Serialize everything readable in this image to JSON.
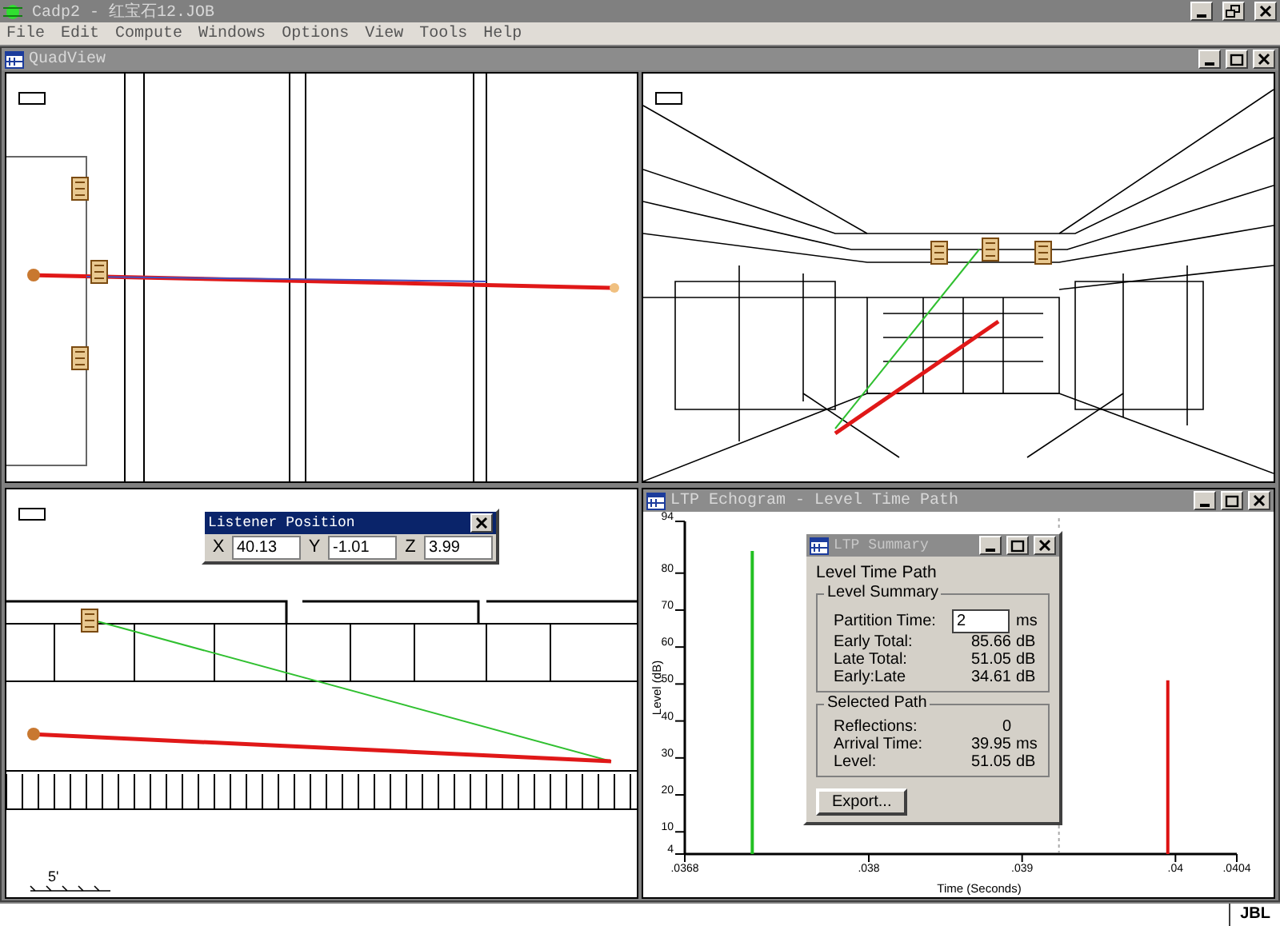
{
  "window": {
    "title": "Cadp2 - 红宝石12.JOB"
  },
  "menu": [
    "File",
    "Edit",
    "Compute",
    "Windows",
    "Options",
    "View",
    "Tools",
    "Help"
  ],
  "quadview": {
    "title": "QuadView"
  },
  "elevation_view": {
    "scale_label": "5'"
  },
  "listener_position": {
    "title": "Listener Position",
    "fields": [
      {
        "label": "X",
        "value": "40.13"
      },
      {
        "label": "Y",
        "value": "-1.01"
      },
      {
        "label": "Z",
        "value": "3.99"
      }
    ]
  },
  "echogram": {
    "title": "LTP Echogram - Level Time Path",
    "chart_data": {
      "type": "bar",
      "xlabel": "Time (Seconds)",
      "ylabel": "Level (dB)",
      "x": [
        0.03724,
        0.03995
      ],
      "series": [
        {
          "color": "#22c022",
          "values": [
            86,
            null
          ]
        },
        {
          "color": "#dd1111",
          "values": [
            null,
            51
          ]
        }
      ],
      "ref_lines": [
        {
          "axis": "x",
          "value": 0.03924
        }
      ],
      "xlim": [
        0.0368,
        0.0404
      ],
      "ylim": [
        4,
        94
      ],
      "xticks": [
        {
          "value": 0.0368,
          "label": ".0368"
        },
        {
          "value": 0.038,
          "label": ".038"
        },
        {
          "value": 0.039,
          "label": ".039"
        },
        {
          "value": 0.04,
          "label": ".04"
        },
        {
          "value": 0.0404,
          "label": ".0404"
        }
      ],
      "yticks": [
        4,
        10,
        20,
        30,
        40,
        50,
        60,
        70,
        80,
        94
      ]
    }
  },
  "ltp_summary": {
    "title": "LTP Summary",
    "heading": "Level Time Path",
    "level_summary": {
      "title": "Level Summary",
      "partition_time": {
        "label": "Partition Time:",
        "value": "2",
        "unit": "ms"
      },
      "rows": [
        {
          "label": "Early Total:",
          "value": "85.66",
          "unit": "dB"
        },
        {
          "label": "Late Total:",
          "value": "51.05",
          "unit": "dB"
        },
        {
          "label": "Early:Late",
          "value": "34.61",
          "unit": "dB"
        }
      ]
    },
    "selected_path": {
      "title": "Selected Path",
      "rows": [
        {
          "label": "Reflections:",
          "value": "0",
          "unit": ""
        },
        {
          "label": "Arrival Time:",
          "value": "39.95",
          "unit": "ms"
        },
        {
          "label": "Level:",
          "value": "51.05",
          "unit": "dB"
        }
      ]
    },
    "export_button": "Export..."
  },
  "status_bar": {
    "right": "JBL"
  }
}
